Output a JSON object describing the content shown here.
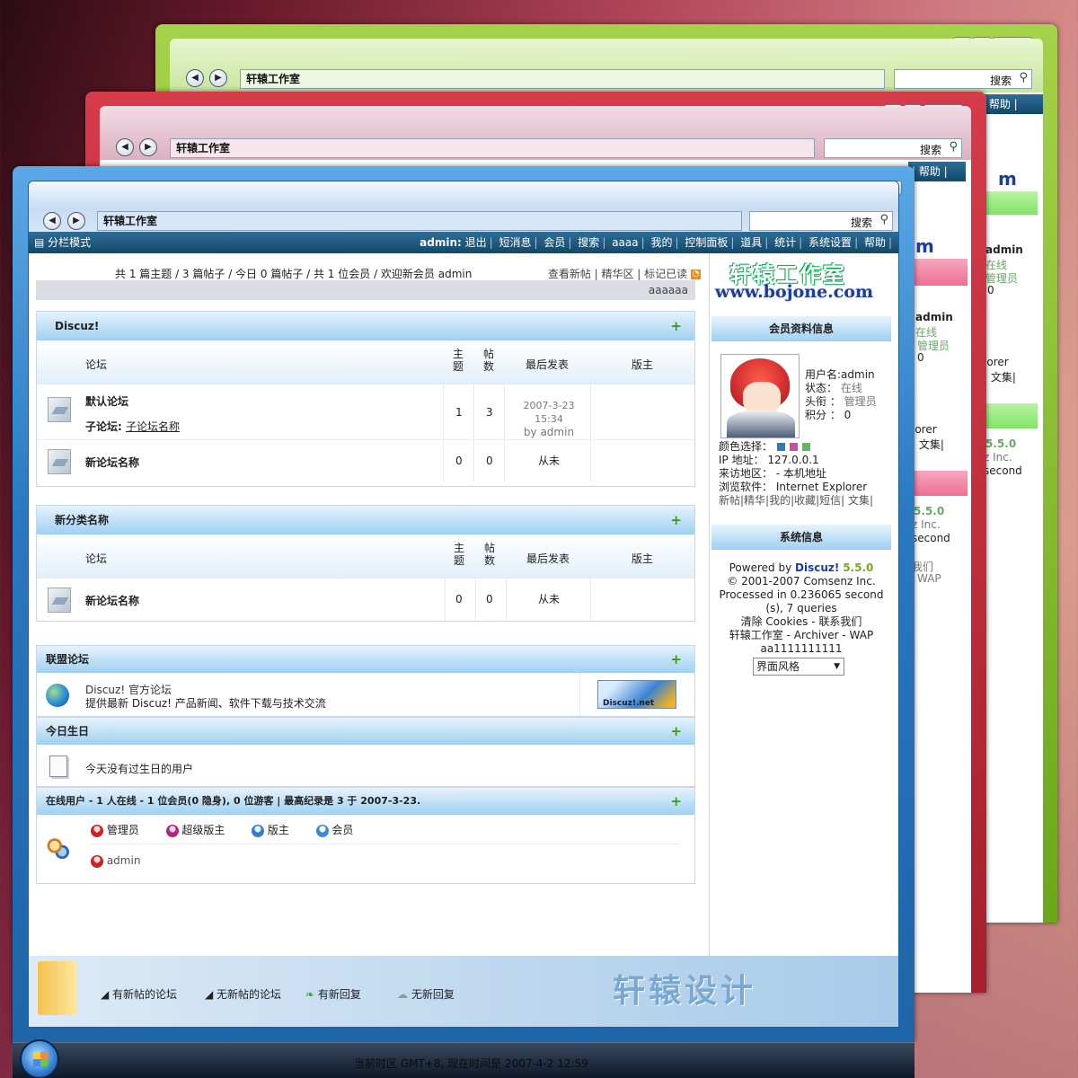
{
  "window": {
    "address": "轩辕工作室",
    "search_label": "搜索"
  },
  "menubar": {
    "left": "分栏模式",
    "user_prefix": "admin:",
    "items": [
      "退出",
      "短消息",
      "会员",
      "搜索",
      "aaaa",
      "我的",
      "控制面板",
      "道具",
      "统计",
      "系统设置",
      "帮助"
    ]
  },
  "back_peek": {
    "green_menu": "| 帮助 |",
    "red_menu": "| 帮助 |",
    "frag_m": "m",
    "frag_admin": "admin",
    "frag_online": "在线",
    "frag_mgr": "管理员",
    "frag_zero": "0",
    "frag_lorer": "lorer",
    "frag_collect": "| 文集|",
    "frag_ver": "5.5.0",
    "frag_inc": "z Inc.",
    "frag_second": "second",
    "frag_contact": "我们",
    "frag_wap": "WAP",
    "frag_lorer2": "lorer",
    "frag_collect2": "| 文集|"
  },
  "stats": {
    "text": "共 1 篇主题 / 3 篇帖子 / 今日 0 篇帖子 / 共 1 位会员 / 欢迎新会员 admin",
    "links": "查看新帖 | 精华区 | 标记已读",
    "marquee": "aaaaaa"
  },
  "sections": {
    "discuz": {
      "title": "Discuz!",
      "plus": "+",
      "cols": {
        "forum": "论坛",
        "topics": "主题",
        "posts": "帖数",
        "last": "最后发表",
        "mod": "版主"
      },
      "rows": [
        {
          "name": "默认论坛",
          "topics": "1",
          "posts": "3",
          "last_time": "2007-3-23 15:34",
          "last_by": "by admin",
          "sub_label": "子论坛:",
          "sub_link": "子论坛名称"
        },
        {
          "name": "新论坛名称",
          "topics": "0",
          "posts": "0",
          "last": "从未"
        }
      ]
    },
    "newcat": {
      "title": "新分类名称",
      "plus": "+",
      "cols": {
        "forum": "论坛",
        "topics": "主题",
        "posts": "帖数",
        "last": "最后发表",
        "mod": "版主"
      },
      "rows": [
        {
          "name": "新论坛名称",
          "topics": "0",
          "posts": "0",
          "last": "从未"
        }
      ]
    },
    "alliance": {
      "title": "联盟论坛",
      "plus": "+",
      "name": "Discuz! 官方论坛",
      "desc": "提供最新 Discuz! 产品新闻、软件下载与技术交流",
      "badge": "Discuz!.net"
    },
    "birthday": {
      "title": "今日生日",
      "plus": "+",
      "text": "今天没有过生日的用户"
    },
    "online": {
      "title": "在线用户 - 1 人在线 - 1 位会员(0 隐身), 0 位游客 | 最高纪录是 3 于 2007-3-23.",
      "plus": "+",
      "legend": [
        "管理员",
        "超级版主",
        "版主",
        "会员"
      ],
      "users": [
        "admin"
      ]
    }
  },
  "sidebar": {
    "logo_cn": "轩辕工作室",
    "logo_en": "www.bojone.com",
    "profile_title": "会员资料信息",
    "username": "用户名:admin",
    "status_label": "状态：",
    "status_value": "在线",
    "title_label": "头衔 ：",
    "title_value": "管理员",
    "points": "积分 ： 0",
    "color_label": "颜色选择：",
    "colors": [
      "#2a7db8",
      "#d04aa0",
      "#5cbb5c"
    ],
    "ip": "IP  地址： 127.0.0.1",
    "from": "来访地区：  - 本机地址",
    "browser": "浏览软件：  Internet Explorer",
    "links": "新帖|精华|我的|收藏|短信| 文集|",
    "sys_title": "系统信息",
    "powered_prefix": "Powered by",
    "powered_brand": "Discuz!",
    "powered_ver": "5.5.0",
    "copyright": "© 2001-2007 Comsenz Inc.",
    "processed": "Processed in 0.236065 second",
    "queries": "(s), 7 queries",
    "links2": "清除 Cookies - 联系我们",
    "links3": "轩辕工作室 - Archiver - WAP",
    "extra": "aa1111111111",
    "style_select": "界面风格"
  },
  "footer": {
    "legend": [
      "有新帖的论坛",
      "无新帖的论坛",
      "有新回复",
      "无新回复"
    ],
    "brand": "轩辕设计"
  },
  "taskbar": {
    "text": "当前时区 GMT+8, 现在时间是 2007-4-2 12:59"
  }
}
